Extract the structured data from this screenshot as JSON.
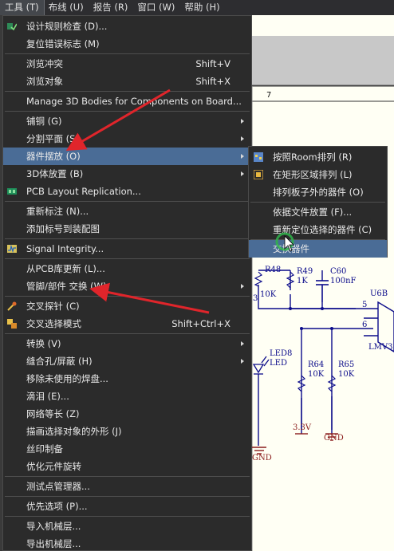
{
  "menubar": {
    "items": [
      "工具 (T)",
      "布线 (U)",
      "报告 (R)",
      "窗口 (W)",
      "帮助 (H)"
    ]
  },
  "menu": {
    "items": [
      {
        "label": "设计规则检查 (D)...",
        "shortcut": "",
        "icon": "drc-check-icon"
      },
      {
        "label": "复位错误标志 (M)",
        "shortcut": ""
      },
      {
        "label": "浏览冲突",
        "shortcut": "Shift+V"
      },
      {
        "label": "浏览对象",
        "shortcut": "Shift+X"
      },
      {
        "label": "Manage 3D Bodies for Components on Board...",
        "shortcut": ""
      },
      {
        "label": "铺铜 (G)",
        "shortcut": ""
      },
      {
        "label": "分割平面 (S)",
        "shortcut": ""
      },
      {
        "label": "器件摆放 (O)",
        "shortcut": ""
      },
      {
        "label": "3D体放置 (B)",
        "shortcut": ""
      },
      {
        "label": "PCB Layout Replication...",
        "shortcut": "",
        "icon": "layout-replication-icon"
      },
      {
        "label": "重新标注 (N)...",
        "shortcut": ""
      },
      {
        "label": "添加标号到装配图",
        "shortcut": ""
      },
      {
        "label": "Signal Integrity...",
        "shortcut": "",
        "icon": "signal-integrity-icon"
      },
      {
        "label": "从PCB库更新 (L)...",
        "shortcut": ""
      },
      {
        "label": "管脚/部件 交换 (W)",
        "shortcut": ""
      },
      {
        "label": "交叉探针 (C)",
        "shortcut": "",
        "icon": "cross-probe-icon"
      },
      {
        "label": "交叉选择模式",
        "shortcut": "Shift+Ctrl+X",
        "icon": "cross-select-icon"
      },
      {
        "label": "转换 (V)",
        "shortcut": ""
      },
      {
        "label": "缝合孔/屏蔽 (H)",
        "shortcut": ""
      },
      {
        "label": "移除未使用的焊盘...",
        "shortcut": ""
      },
      {
        "label": "滴泪 (E)...",
        "shortcut": ""
      },
      {
        "label": "网络等长 (Z)",
        "shortcut": ""
      },
      {
        "label": "描画选择对象的外形 (J)",
        "shortcut": ""
      },
      {
        "label": "丝印制备",
        "shortcut": ""
      },
      {
        "label": "优化元件旋转",
        "shortcut": ""
      },
      {
        "label": "测试点管理器...",
        "shortcut": ""
      },
      {
        "label": "优先选项 (P)...",
        "shortcut": ""
      },
      {
        "label": "导入机械层...",
        "shortcut": ""
      },
      {
        "label": "导出机械层...",
        "shortcut": ""
      }
    ]
  },
  "submenu": {
    "items": [
      {
        "label": "按照Room排列 (R)",
        "icon": "room-arrange-icon"
      },
      {
        "label": "在矩形区域排列 (L)",
        "icon": "rect-arrange-icon"
      },
      {
        "label": "排列板子外的器件 (O)"
      },
      {
        "label": "依据文件放置 (F)..."
      },
      {
        "label": "重新定位选择的器件 (C)"
      },
      {
        "label": "交换器件"
      }
    ]
  },
  "schematic": {
    "col_number": "7",
    "digit_4": "4",
    "r48": "R48",
    "r48_val": "10K",
    "r49": "R49",
    "r49_val": "1K",
    "c60": "C60",
    "c60_val": "100nF",
    "u6b": "U6B",
    "pin5": "5",
    "pin6": "6",
    "pin3": "3",
    "led8": "LED8",
    "led8_val": "LED",
    "r64": "R64",
    "r64_val": "10K",
    "r65": "R65",
    "r65_val": "10K",
    "v33": "3.3V",
    "gnd1": "GND",
    "gnd2": "GND",
    "lmv": "LMV3"
  },
  "colors": {
    "menu_bg": "#2b2b2b",
    "highlight": "#4a6c96",
    "arrow": "#e0252b",
    "wire": "#0b0b8a",
    "power": "#8a1b1b"
  }
}
